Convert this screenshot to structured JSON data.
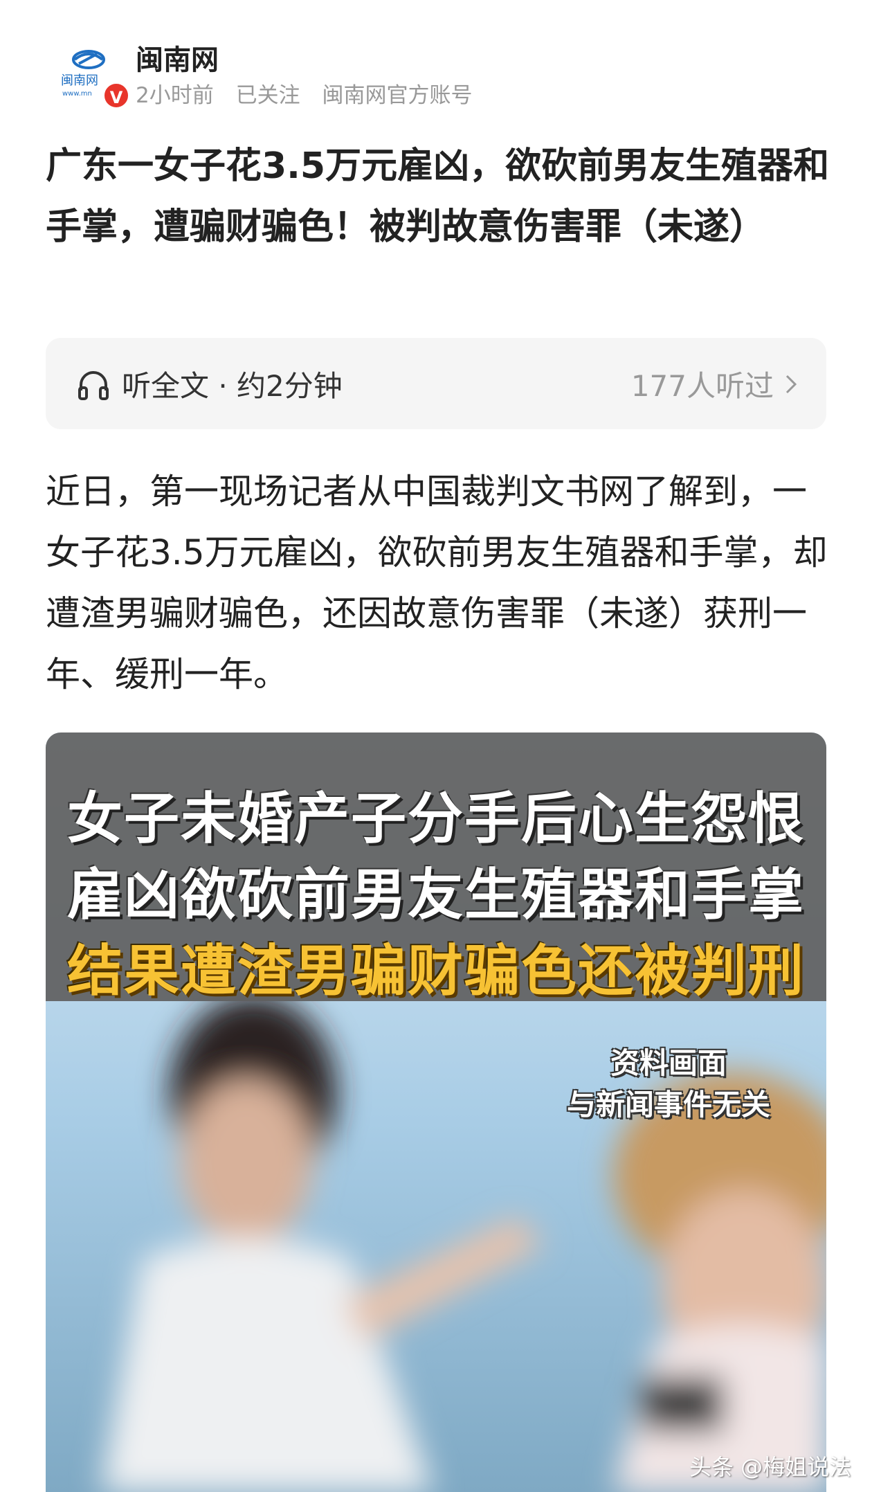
{
  "header": {
    "account_name": "闽南网",
    "time": "2小时前",
    "follow_status": "已关注",
    "account_type": "闽南网官方账号",
    "logo_text": "闽南网",
    "logo_url_text": "www.mn",
    "verified_badge": "V"
  },
  "article": {
    "title": "广东一女子花3.5万元雇凶，欲砍前男友生殖器和手掌，遭骗财骗色！被判故意伤害罪（未遂）",
    "listen_label": "听全文 · 约2分钟",
    "listen_count": "177人听过",
    "body": "近日，第一现场记者从中国裁判文书网了解到，一女子花3.5万元雇凶，欲砍前男友生殖器和手掌，却遭渣男骗财骗色，还因故意伤害罪（未遂）获刑一年、缓刑一年。"
  },
  "media": {
    "caption_line1": "女子未婚产子分手后心生怨恨",
    "caption_line2": "雇凶欲砍前男友生殖器和手掌",
    "caption_line3": "结果遭渣男骗财骗色还被判刑",
    "disclaimer_line1": "资料画面",
    "disclaimer_line2": "与新闻事件无关"
  },
  "watermark": "头条 @梅姐说法",
  "colors": {
    "verified_red": "#e8352b",
    "caption_yellow": "#f7c234",
    "meta_gray": "#999999",
    "listen_bg": "#f5f5f5"
  },
  "icons": {
    "listen": "headphone-icon",
    "more": "chevron-right-icon"
  }
}
